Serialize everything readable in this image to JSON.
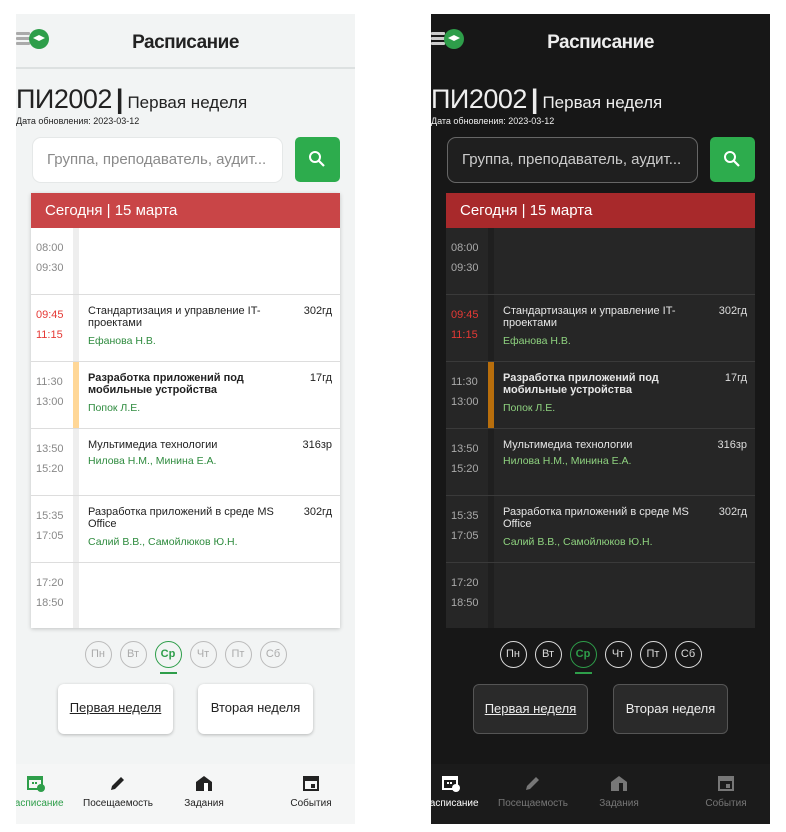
{
  "app": {
    "title": "Расписание"
  },
  "header": {
    "group": "ПИ2002",
    "separator": "|",
    "week": "Первая неделя",
    "updated": "Дата обновления: 2023-03-12"
  },
  "search": {
    "placeholder": "Группа, преподаватель, аудит..."
  },
  "day_header": "Сегодня | 15 марта",
  "lessons": [
    {
      "start": "08:00",
      "end": "09:30",
      "subject": "",
      "teacher": "",
      "room": ""
    },
    {
      "start": "09:45",
      "end": "11:15",
      "subject": "Стандартизация и управление IT-проектами",
      "teacher": "Ефанова Н.В.",
      "room": "302гд"
    },
    {
      "start": "11:30",
      "end": "13:00",
      "subject": "Разработка приложений под мобильные устройства",
      "teacher": "Попок Л.Е.",
      "room": "17гд"
    },
    {
      "start": "13:50",
      "end": "15:20",
      "subject": "Мультимедиа технологии",
      "teacher": "Нилова Н.М., Минина Е.А.",
      "room": "316зр"
    },
    {
      "start": "15:35",
      "end": "17:05",
      "subject": "Разработка приложений в среде MS Office",
      "teacher": "Салий В.В., Самойлюков Ю.Н.",
      "room": "302гд"
    },
    {
      "start": "17:20",
      "end": "18:50",
      "subject": "",
      "teacher": "",
      "room": ""
    }
  ],
  "weekdays": [
    "Пн",
    "Вт",
    "Ср",
    "Чт",
    "Пт",
    "Сб"
  ],
  "selected_weekday": "Ср",
  "week_buttons": {
    "first": "Первая неделя",
    "second": "Вторая неделя"
  },
  "nav": {
    "schedule": "Расписание",
    "attendance": "Посещаемость",
    "tasks": "Задания",
    "events": "События"
  },
  "icons": [
    "menu-icon",
    "graduation-cap-icon",
    "search-icon",
    "calendar-clock-icon",
    "pencil-icon",
    "house-icon",
    "calendar-icon"
  ],
  "colors": {
    "accent": "#2e9e4a",
    "today_light": "#c94547",
    "today_dark": "#a8292b",
    "current_time": "#e53935",
    "current_bar_light": "#ffd797",
    "current_bar_dark": "#b86e0c"
  }
}
